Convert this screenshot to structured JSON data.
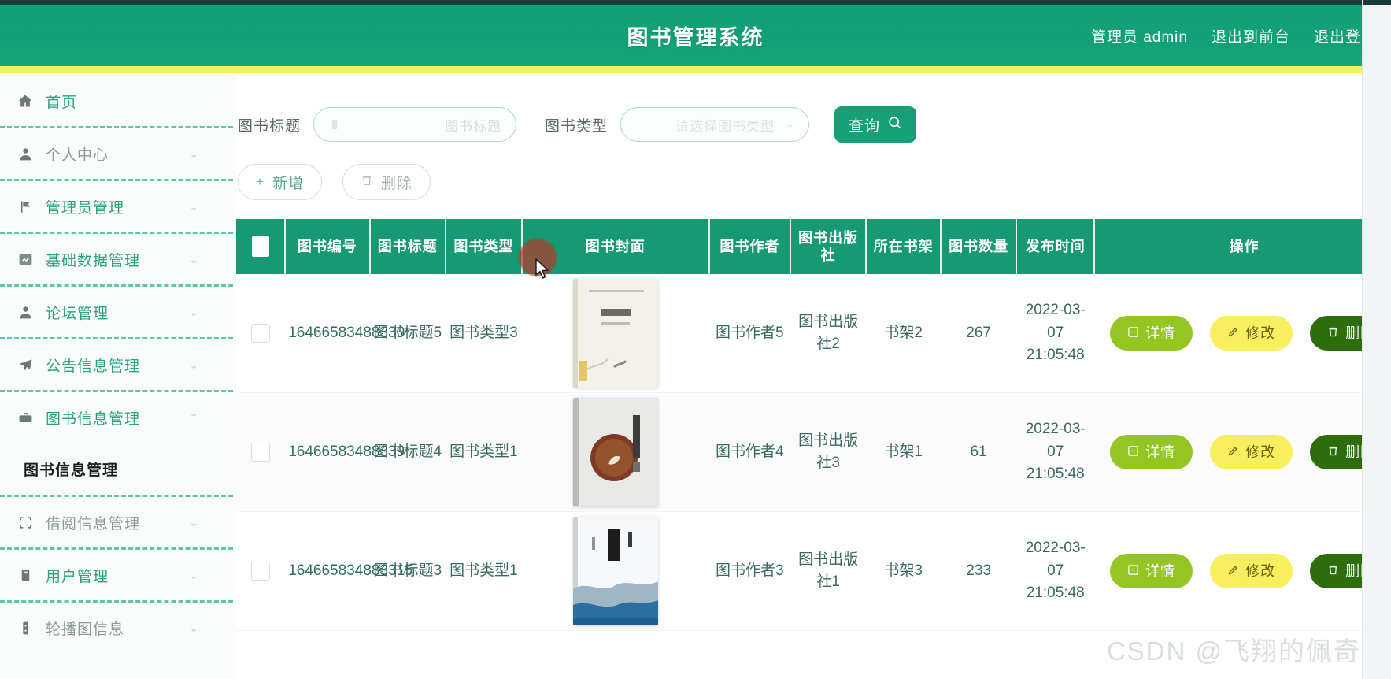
{
  "header": {
    "title": "图书管理系统",
    "user": "管理员 admin",
    "logout_front": "退出到前台",
    "logout": "退出登录",
    "bg_color": "#14a077",
    "strip_color": "#f7f05a"
  },
  "sidebar": {
    "items": [
      {
        "label": "首页",
        "icon": "home-icon",
        "has_chevron": false,
        "expanded": false,
        "active_color": "#2aa37c"
      },
      {
        "label": "个人中心",
        "icon": "user-icon",
        "has_chevron": true,
        "expanded": false
      },
      {
        "label": "管理员管理",
        "icon": "flag-icon",
        "has_chevron": true,
        "expanded": false
      },
      {
        "label": "基础数据管理",
        "icon": "chart-icon",
        "has_chevron": true,
        "expanded": false
      },
      {
        "label": "论坛管理",
        "icon": "user-icon",
        "has_chevron": true,
        "expanded": false
      },
      {
        "label": "公告信息管理",
        "icon": "send-icon",
        "has_chevron": true,
        "expanded": false
      },
      {
        "label": "图书信息管理",
        "icon": "briefcase-icon",
        "has_chevron": true,
        "expanded": true
      },
      {
        "label": "借阅信息管理",
        "icon": "scan-icon",
        "has_chevron": true,
        "expanded": false
      },
      {
        "label": "用户管理",
        "icon": "clipboard-icon",
        "has_chevron": true,
        "expanded": false
      },
      {
        "label": "轮播图信息",
        "icon": "image-icon",
        "has_chevron": true,
        "expanded": false
      }
    ],
    "submenu": {
      "label": "图书信息管理"
    }
  },
  "filters": {
    "title_label": "图书标题",
    "title_placeholder": "图书标题",
    "title_value": "",
    "type_label": "图书类型",
    "type_placeholder": "请选择图书类型",
    "type_value": "",
    "search_button": "查询"
  },
  "actions": {
    "add": "新增",
    "delete": "删除",
    "add_icon": "+",
    "delete_icon": "trash-icon"
  },
  "table": {
    "columns": [
      "图书编号",
      "图书标题",
      "图书类型",
      "图书封面",
      "图书作者",
      "图书出版社",
      "所在书架",
      "图书数量",
      "发布时间",
      "操作"
    ],
    "rows": [
      {
        "id": "16466583488330",
        "title": "图书标题5",
        "type": "图书类型3",
        "cover": "white-book-cover",
        "author": "图书作者5",
        "publisher": "图书出版社2",
        "shelf": "书架2",
        "quantity": "267",
        "publish_time": "2022-03-07 21:05:48"
      },
      {
        "id": "16466583488339",
        "title": "图书标题4",
        "type": "图书类型1",
        "cover": "sanguo-book-cover",
        "author": "图书作者4",
        "publisher": "图书出版社3",
        "shelf": "书架1",
        "quantity": "61",
        "publish_time": "2022-03-07 21:05:48"
      },
      {
        "id": "164665834883315",
        "title": "图书标题3",
        "type": "图书类型1",
        "cover": "huozhe-book-cover",
        "author": "图书作者3",
        "publisher": "图书出版社1",
        "shelf": "书架3",
        "quantity": "233",
        "publish_time": "2022-03-07 21:05:48"
      }
    ],
    "row_actions": {
      "detail": "详情",
      "edit": "修改",
      "delete": "删除",
      "detail_color": "#93c523",
      "edit_color": "#f7ef5e",
      "delete_color": "#2d6d0c"
    }
  },
  "watermark": "CSDN @飞翔的佩奇"
}
